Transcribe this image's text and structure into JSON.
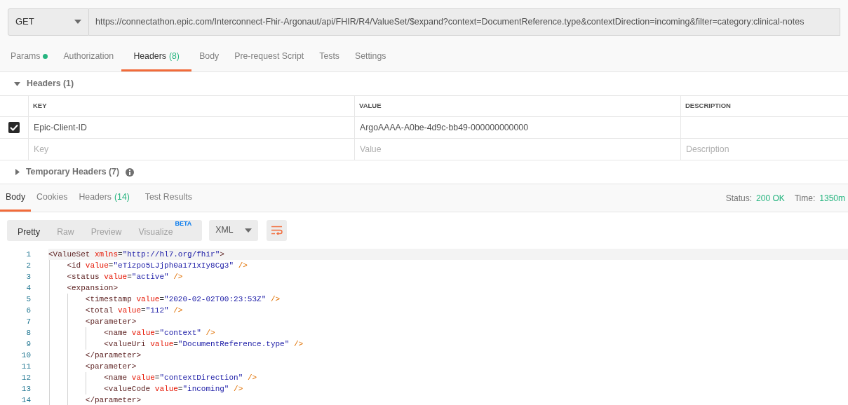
{
  "request": {
    "method": "GET",
    "url": "https://connectathon.epic.com/Interconnect-Fhir-Argonaut/api/FHIR/R4/ValueSet/$expand?context=DocumentReference.type&contextDirection=incoming&filter=category:clinical-notes"
  },
  "request_tabs": [
    {
      "label": "Params",
      "dot": true,
      "selected": false
    },
    {
      "label": "Authorization",
      "dot": false,
      "selected": false
    },
    {
      "label": "Headers",
      "count": "(8)",
      "dot": false,
      "selected": true
    },
    {
      "label": "Body",
      "dot": false,
      "selected": false
    },
    {
      "label": "Pre-request Script",
      "dot": false,
      "selected": false
    },
    {
      "label": "Tests",
      "dot": false,
      "selected": false
    },
    {
      "label": "Settings",
      "dot": false,
      "selected": false
    }
  ],
  "headers_section": {
    "title": "Headers (1)",
    "expanded": true
  },
  "headers_table": {
    "columns": [
      "KEY",
      "VALUE",
      "DESCRIPTION"
    ],
    "rows": [
      {
        "checked": true,
        "key": "Epic-Client-ID",
        "value": "ArgoAAAA-A0be-4d9c-bb49-000000000000"
      }
    ],
    "new_row": {
      "key_placeholder": "Key",
      "value_placeholder": "Value",
      "description_placeholder": "Description"
    }
  },
  "temporary_headers": {
    "title": "Temporary Headers (7)",
    "expanded": false
  },
  "response_tabs": [
    {
      "label": "Body",
      "selected": true
    },
    {
      "label": "Cookies",
      "selected": false
    },
    {
      "label": "Headers",
      "count": "(14)",
      "selected": false
    },
    {
      "label": "Test Results",
      "selected": false
    }
  ],
  "status": {
    "status_label": "Status:",
    "status_value": "200 OK",
    "time_label": "Time:",
    "time_value": "1350m"
  },
  "view_modes": [
    {
      "label": "Pretty",
      "selected": true
    },
    {
      "label": "Raw",
      "selected": false
    },
    {
      "label": "Preview",
      "selected": false
    },
    {
      "label": "Visualize",
      "badge": "BETA",
      "selected": false
    }
  ],
  "format": "XML",
  "code_lines": [
    {
      "number": "1",
      "tokens": [
        {
          "kind": "tag",
          "text": "<ValueSet "
        },
        {
          "kind": "attr",
          "text": "xmlns"
        },
        {
          "kind": "punct",
          "text": "="
        },
        {
          "kind": "value",
          "text": "\"http://hl7.org/fhir\""
        },
        {
          "kind": "tag",
          "text": ">"
        }
      ]
    },
    {
      "number": "2",
      "tokens": [
        {
          "kind": "tag",
          "text": "    <id "
        },
        {
          "kind": "attr",
          "text": "value"
        },
        {
          "kind": "punct",
          "text": "="
        },
        {
          "kind": "value",
          "text": "\"eTizpo5LJjph0a171xIy8Cg3\""
        },
        {
          "kind": "end",
          "text": " />"
        }
      ]
    },
    {
      "number": "3",
      "tokens": [
        {
          "kind": "tag",
          "text": "    <status "
        },
        {
          "kind": "attr",
          "text": "value"
        },
        {
          "kind": "punct",
          "text": "="
        },
        {
          "kind": "value",
          "text": "\"active\""
        },
        {
          "kind": "end",
          "text": " />"
        }
      ]
    },
    {
      "number": "4",
      "tokens": [
        {
          "kind": "tag",
          "text": "    <expansion>"
        }
      ]
    },
    {
      "number": "5",
      "tokens": [
        {
          "kind": "tag",
          "text": "        <timestamp "
        },
        {
          "kind": "attr",
          "text": "value"
        },
        {
          "kind": "punct",
          "text": "="
        },
        {
          "kind": "value",
          "text": "\"2020-02-02T00:23:53Z\""
        },
        {
          "kind": "end",
          "text": " />"
        }
      ]
    },
    {
      "number": "6",
      "tokens": [
        {
          "kind": "tag",
          "text": "        <total "
        },
        {
          "kind": "attr",
          "text": "value"
        },
        {
          "kind": "punct",
          "text": "="
        },
        {
          "kind": "value",
          "text": "\"112\""
        },
        {
          "kind": "end",
          "text": " />"
        }
      ]
    },
    {
      "number": "7",
      "tokens": [
        {
          "kind": "tag",
          "text": "        <parameter>"
        }
      ]
    },
    {
      "number": "8",
      "tokens": [
        {
          "kind": "tag",
          "text": "            <name "
        },
        {
          "kind": "attr",
          "text": "value"
        },
        {
          "kind": "punct",
          "text": "="
        },
        {
          "kind": "value",
          "text": "\"context\""
        },
        {
          "kind": "end",
          "text": " />"
        }
      ]
    },
    {
      "number": "9",
      "tokens": [
        {
          "kind": "tag",
          "text": "            <valueUri "
        },
        {
          "kind": "attr",
          "text": "value"
        },
        {
          "kind": "punct",
          "text": "="
        },
        {
          "kind": "value",
          "text": "\"DocumentReference.type\""
        },
        {
          "kind": "end",
          "text": " />"
        }
      ]
    },
    {
      "number": "10",
      "tokens": [
        {
          "kind": "tag",
          "text": "        </parameter>"
        }
      ]
    },
    {
      "number": "11",
      "tokens": [
        {
          "kind": "tag",
          "text": "        <parameter>"
        }
      ]
    },
    {
      "number": "12",
      "tokens": [
        {
          "kind": "tag",
          "text": "            <name "
        },
        {
          "kind": "attr",
          "text": "value"
        },
        {
          "kind": "punct",
          "text": "="
        },
        {
          "kind": "value",
          "text": "\"contextDirection\""
        },
        {
          "kind": "end",
          "text": " />"
        }
      ]
    },
    {
      "number": "13",
      "tokens": [
        {
          "kind": "tag",
          "text": "            <valueCode "
        },
        {
          "kind": "attr",
          "text": "value"
        },
        {
          "kind": "punct",
          "text": "="
        },
        {
          "kind": "value",
          "text": "\"incoming\""
        },
        {
          "kind": "end",
          "text": " />"
        }
      ]
    },
    {
      "number": "14",
      "tokens": [
        {
          "kind": "tag",
          "text": "        </parameter>"
        }
      ]
    }
  ]
}
